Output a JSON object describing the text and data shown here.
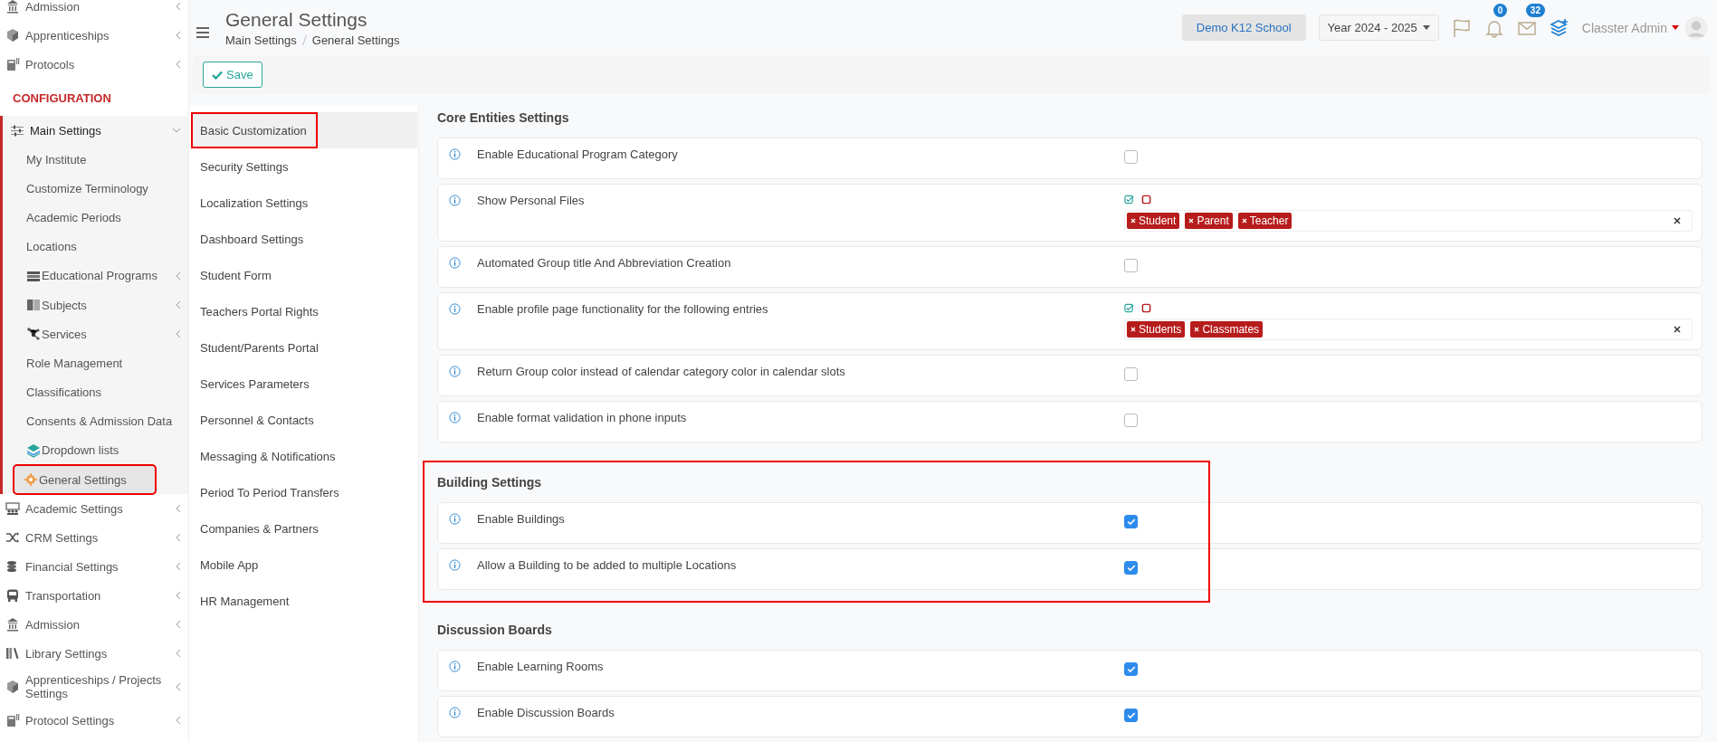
{
  "sidebar": {
    "items": [
      {
        "kind": "item",
        "label": "Admission",
        "has_submenu": true
      },
      {
        "kind": "item",
        "label": "Apprenticeships",
        "has_submenu": true
      },
      {
        "kind": "item",
        "label": "Protocols",
        "has_submenu": true
      },
      {
        "kind": "heading",
        "label": "CONFIGURATION"
      },
      {
        "kind": "group",
        "label": "Main Settings",
        "expanded": true,
        "children": [
          {
            "label": "My Institute",
            "has_submenu": false,
            "selected": false,
            "highlighted": false
          },
          {
            "label": "Customize Terminology",
            "has_submenu": false,
            "selected": false,
            "highlighted": false
          },
          {
            "label": "Academic Periods",
            "has_submenu": false,
            "selected": false,
            "highlighted": false
          },
          {
            "label": "Locations",
            "has_submenu": false,
            "selected": false,
            "highlighted": false
          },
          {
            "label": "Educational Programs",
            "has_submenu": true,
            "selected": false,
            "highlighted": false
          },
          {
            "label": "Subjects",
            "has_submenu": true,
            "selected": false,
            "highlighted": false
          },
          {
            "label": "Services",
            "has_submenu": true,
            "selected": false,
            "highlighted": false
          },
          {
            "label": "Role Management",
            "has_submenu": false,
            "selected": false,
            "highlighted": false
          },
          {
            "label": "Classifications",
            "has_submenu": false,
            "selected": false,
            "highlighted": false
          },
          {
            "label": "Consents & Admission Data",
            "has_submenu": false,
            "selected": false,
            "highlighted": false
          },
          {
            "label": "Dropdown lists",
            "has_submenu": false,
            "selected": false,
            "highlighted": false
          },
          {
            "label": "General Settings",
            "has_submenu": false,
            "selected": true,
            "highlighted": true
          }
        ]
      },
      {
        "kind": "item",
        "label": "Academic Settings",
        "has_submenu": true
      },
      {
        "kind": "item",
        "label": "CRM Settings",
        "has_submenu": true
      },
      {
        "kind": "item",
        "label": "Financial Settings",
        "has_submenu": true
      },
      {
        "kind": "item",
        "label": "Transportation",
        "has_submenu": true
      },
      {
        "kind": "item",
        "label": "Admission",
        "has_submenu": true
      },
      {
        "kind": "item",
        "label": "Library Settings",
        "has_submenu": true
      },
      {
        "kind": "item",
        "label": "Apprenticeships / Projects Settings",
        "has_submenu": true
      },
      {
        "kind": "item",
        "label": "Protocol Settings",
        "has_submenu": true
      }
    ]
  },
  "header": {
    "title": "General Settings",
    "breadcrumb": [
      "Main Settings",
      "General Settings"
    ],
    "school": "Demo K12 School",
    "year": "Year 2024 - 2025",
    "notifications": "0",
    "messages": "32",
    "user": "Classter Admin"
  },
  "toolbar": {
    "save": "Save"
  },
  "settings_nav": [
    {
      "label": "Basic Customization",
      "selected": true,
      "highlighted": true
    },
    {
      "label": "Security Settings",
      "selected": false,
      "highlighted": false
    },
    {
      "label": "Localization Settings",
      "selected": false,
      "highlighted": false
    },
    {
      "label": "Dashboard Settings",
      "selected": false,
      "highlighted": false
    },
    {
      "label": "Student Form",
      "selected": false,
      "highlighted": false
    },
    {
      "label": "Teachers Portal Rights",
      "selected": false,
      "highlighted": false
    },
    {
      "label": "Student/Parents Portal",
      "selected": false,
      "highlighted": false
    },
    {
      "label": "Services Parameters",
      "selected": false,
      "highlighted": false
    },
    {
      "label": "Personnel & Contacts",
      "selected": false,
      "highlighted": false
    },
    {
      "label": "Messaging & Notifications",
      "selected": false,
      "highlighted": false
    },
    {
      "label": "Period To Period Transfers",
      "selected": false,
      "highlighted": false
    },
    {
      "label": "Companies & Partners",
      "selected": false,
      "highlighted": false
    },
    {
      "label": "Mobile App",
      "selected": false,
      "highlighted": false
    },
    {
      "label": "HR Management",
      "selected": false,
      "highlighted": false
    }
  ],
  "sections": [
    {
      "title": "Core Entities Settings",
      "highlighted": false,
      "rows": [
        {
          "kind": "checkbox",
          "label": "Enable Educational Program Category",
          "checked": false
        },
        {
          "kind": "tags",
          "label": "Show Personal Files",
          "tags": [
            "Student",
            "Parent",
            "Teacher"
          ]
        },
        {
          "kind": "checkbox",
          "label": "Automated Group title And Abbreviation Creation",
          "checked": false
        },
        {
          "kind": "tags",
          "label": "Enable profile page functionality for the following entries",
          "tags": [
            "Students",
            "Classmates"
          ]
        },
        {
          "kind": "checkbox",
          "label": "Return Group color instead of calendar category color in calendar slots",
          "checked": false
        },
        {
          "kind": "checkbox",
          "label": "Enable format validation in phone inputs",
          "checked": false
        }
      ]
    },
    {
      "title": "Building Settings",
      "highlighted": true,
      "rows": [
        {
          "kind": "checkbox",
          "label": "Enable Buildings",
          "checked": true
        },
        {
          "kind": "checkbox",
          "label": "Allow a Building to be added to multiple Locations",
          "checked": true
        }
      ]
    },
    {
      "title": "Discussion Boards",
      "highlighted": false,
      "rows": [
        {
          "kind": "checkbox",
          "label": "Enable Learning Rooms",
          "checked": true
        },
        {
          "kind": "checkbox",
          "label": "Enable Discussion Boards",
          "checked": true
        }
      ]
    }
  ]
}
